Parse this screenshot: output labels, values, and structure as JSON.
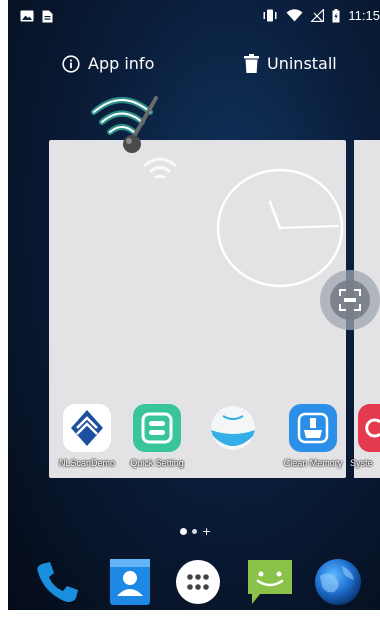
{
  "status_bar": {
    "time": "11:15",
    "left_icons": [
      "image-icon",
      "document-icon"
    ],
    "right_icons": [
      "vibrate-icon",
      "wifi-icon",
      "no-signal-icon",
      "battery-icon"
    ]
  },
  "actions": {
    "app_info_label": "App info",
    "uninstall_label": "Uninstall"
  },
  "card_apps": [
    {
      "label": "NLScanDemo",
      "icon": "nlscan-app-icon"
    },
    {
      "label": "Quick Setting",
      "icon": "quick-setting-app-icon"
    },
    {
      "label": "",
      "icon": "sea-app-icon"
    },
    {
      "label": "Clean Memory",
      "icon": "clean-memory-app-icon"
    },
    {
      "label": "Syste",
      "icon": "system-app-icon"
    }
  ],
  "dock": [
    "phone-icon",
    "contacts-icon",
    "all-apps-icon",
    "messaging-icon",
    "browser-globe-icon"
  ],
  "colors": {
    "wallpaper": "#0a1d3a",
    "card": "#e3e3e6",
    "phone": "#1a8fe0",
    "contacts": "#1e88e5",
    "messaging": "#8bc34a",
    "quick_setting": "#39c59a",
    "clean_memory": "#2b8fe8",
    "system": "#e53950"
  }
}
